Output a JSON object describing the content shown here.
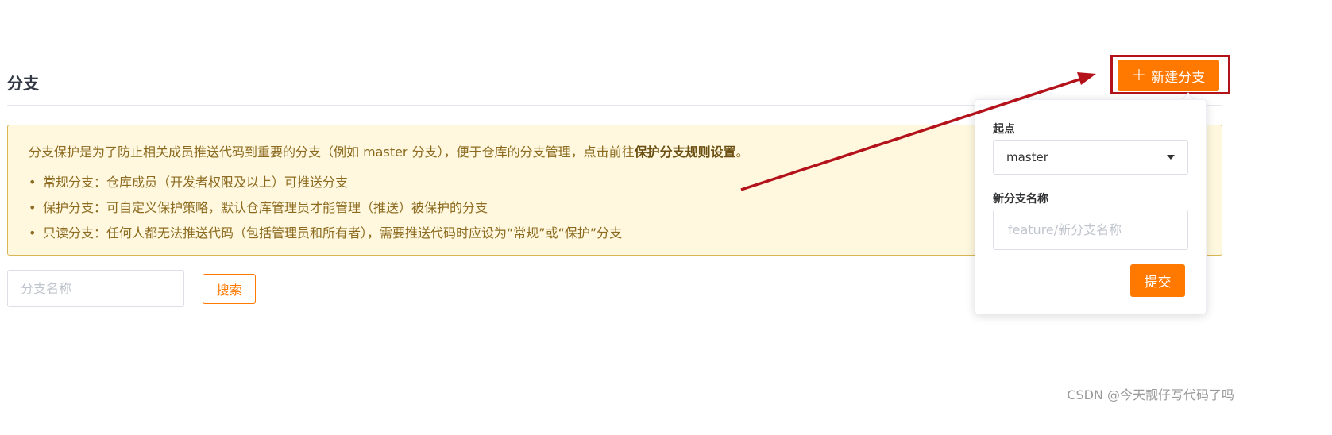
{
  "page": {
    "title": "分支",
    "new_branch_label": "新建分支",
    "new_branch_icon": "plus-icon"
  },
  "notice": {
    "intro": "分支保护是为了防止相关成员推送代码到重要的分支（例如 master 分支），便于仓库的分支管理，点击前往",
    "intro_link": "保护分支规则设置",
    "intro_end": "。",
    "items": [
      "常规分支：仓库成员（开发者权限及以上）可推送分支",
      "保护分支：可自定义保护策略，默认仓库管理员才能管理（推送）被保护的分支",
      "只读分支：任何人都无法推送代码（包括管理员和所有者），需要推送代码时应设为“常规”或“保护”分支"
    ]
  },
  "search": {
    "placeholder": "分支名称",
    "button_label": "搜索"
  },
  "popover": {
    "origin_label": "起点",
    "origin_value": "master",
    "name_label": "新分支名称",
    "name_placeholder": "feature/新分支名称",
    "submit_label": "提交"
  },
  "colors": {
    "accent": "#ff7800",
    "annotation": "#b3121a",
    "notice_bg": "#fff8de",
    "notice_border": "#d9b554",
    "notice_text": "#8c6a1f"
  },
  "watermark": "CSDN @今天靓仔写代码了吗"
}
